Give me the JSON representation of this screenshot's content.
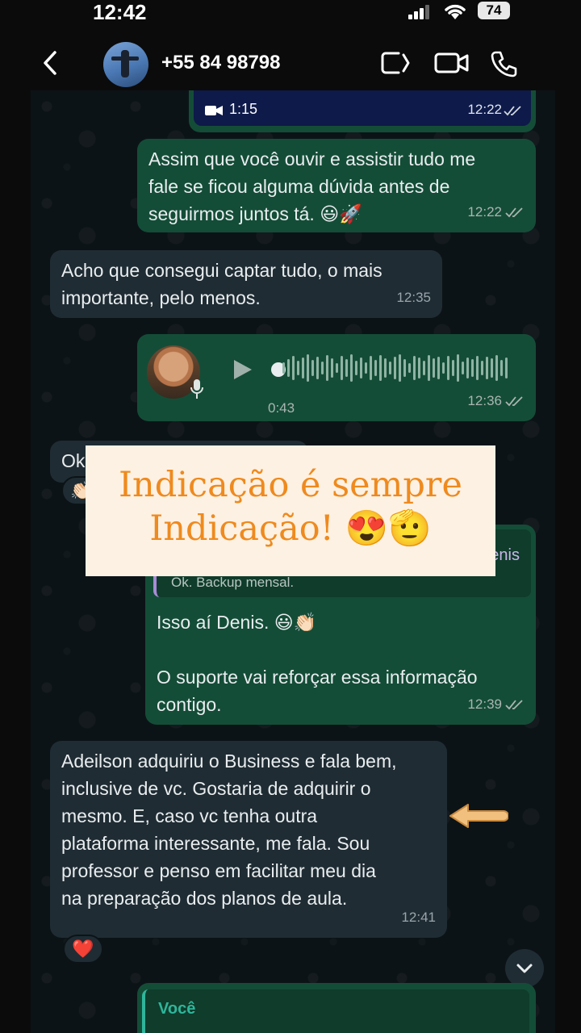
{
  "status_bar": {
    "time": "12:42",
    "battery": "74"
  },
  "header": {
    "contact_name": "+55 84 98798",
    "icons": [
      "back-chevron-icon",
      "lens-icon",
      "video-call-icon",
      "phone-icon"
    ]
  },
  "messages": {
    "video": {
      "duration": "1:15",
      "time": "12:22"
    },
    "m1": {
      "text": "Assim que você ouvir e assistir tudo me\nfale se ficou alguma dúvida antes de\nseguirmos juntos tá. 😃🚀",
      "time": "12:22"
    },
    "m2": {
      "text": "Acho que consegui captar tudo, o mais\nimportante, pelo menos.",
      "time": "12:35"
    },
    "audio": {
      "duration": "0:43",
      "time": "12:36"
    },
    "m3_partial": {
      "text": "Ok"
    },
    "m3_reaction": "👏🏻",
    "reply": {
      "quoted_author_tail": "enis",
      "quoted_text": "Ok. Backup mensal.",
      "text": "Isso aí Denis. 😃👏🏻\n\nO suporte vai reforçar essa informação\ncontigo.",
      "time": "12:39"
    },
    "m4": {
      "text": "Adeilson adquiriu o Business e fala bem,\ninclusive de vc. Gostaria de adquirir o\nmesmo. E, caso vc tenha outra\nplataforma interessante, me fala. Sou\nprofessor e penso em facilitar meu dia\nna preparação dos planos de aula.",
      "time": "12:41"
    },
    "m4_reaction": "❤️",
    "last_partial": {
      "author": "Você"
    }
  },
  "overlay": {
    "line1": "Indicação é sempre",
    "line2": "Indicação! 😍🫡"
  },
  "colors": {
    "outgoing": "#144d37",
    "incoming": "#1f2c33",
    "overlay_bg": "#fdf1e3",
    "overlay_text": "#ef8a1e"
  }
}
